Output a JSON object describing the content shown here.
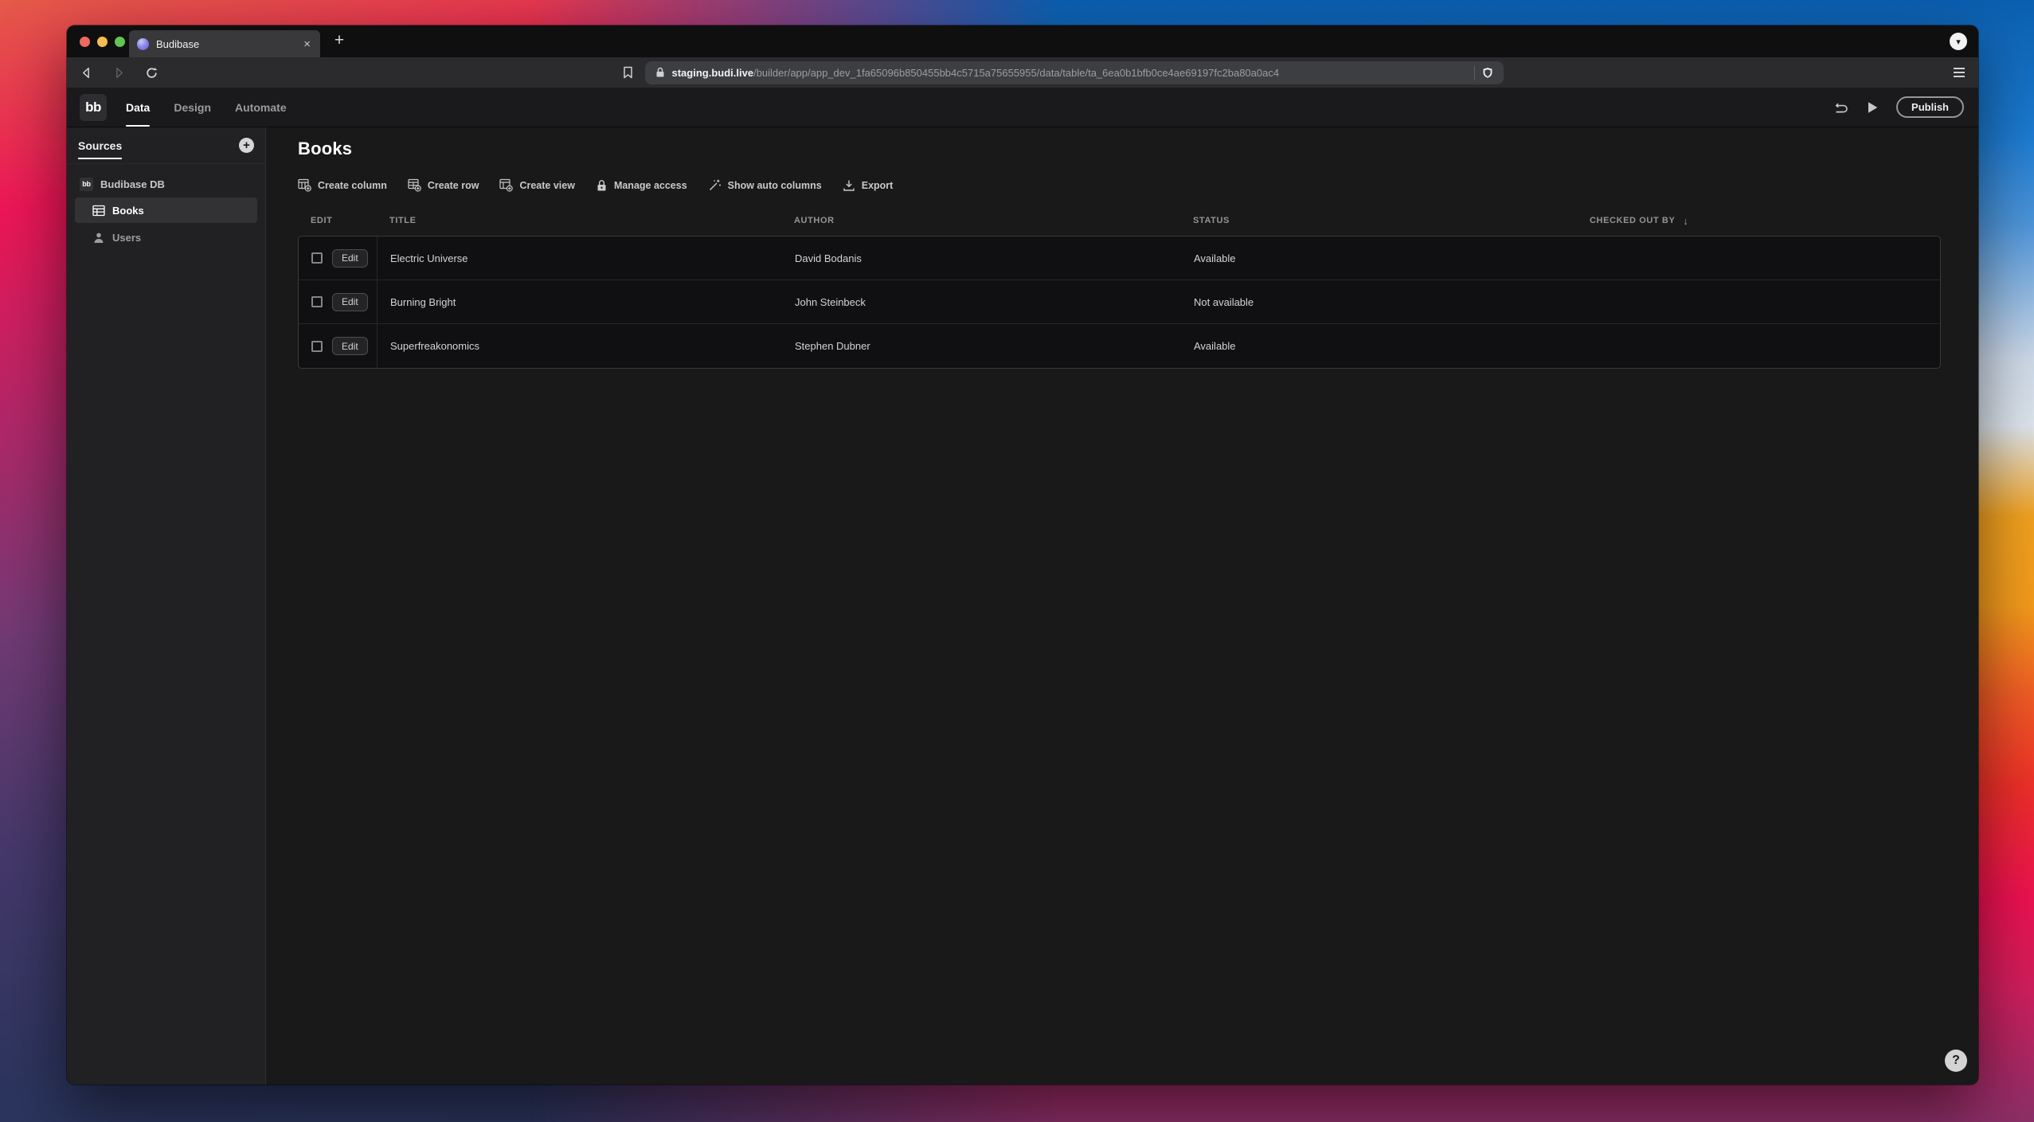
{
  "browser": {
    "tab": {
      "title": "Budibase"
    },
    "url": {
      "domain": "staging.budi.live",
      "path": "/builder/app/app_dev_1fa65096b850455bb4c5715a75655955/data/table/ta_6ea0b1bfb0ce4ae69197fc2ba80a0ac4"
    }
  },
  "icons": {
    "close": "×",
    "plus": "+",
    "chevron_down": "▾",
    "sort_desc": "↓",
    "help": "?"
  },
  "app": {
    "logo": "bb",
    "logo_mini": "bb",
    "nav_tabs": [
      {
        "label": "Data"
      },
      {
        "label": "Design"
      },
      {
        "label": "Automate"
      }
    ],
    "publish_label": "Publish"
  },
  "sidebar": {
    "title": "Sources",
    "datasource": "Budibase DB",
    "items": [
      {
        "label": "Books"
      },
      {
        "label": "Users"
      }
    ]
  },
  "main": {
    "title": "Books",
    "actions": [
      {
        "label": "Create column",
        "icon": "table-add-icon"
      },
      {
        "label": "Create row",
        "icon": "table-add-icon"
      },
      {
        "label": "Create view",
        "icon": "table-add-icon"
      },
      {
        "label": "Manage access",
        "icon": "lock-icon"
      },
      {
        "label": "Show auto columns",
        "icon": "magic-wand-icon"
      },
      {
        "label": "Export",
        "icon": "download-icon"
      }
    ],
    "table": {
      "columns": [
        "Edit",
        "Title",
        "Author",
        "Status",
        "Checked out by"
      ],
      "edit_label": "Edit",
      "rows": [
        {
          "title": "Electric Universe",
          "author": "David Bodanis",
          "status": "Available",
          "checked_out_by": ""
        },
        {
          "title": "Burning Bright",
          "author": "John Steinbeck",
          "status": "Not available",
          "checked_out_by": ""
        },
        {
          "title": "Superfreakonomics",
          "author": "Stephen Dubner",
          "status": "Available",
          "checked_out_by": ""
        }
      ]
    }
  },
  "colors": {
    "traffic_close": "#ee6a5e",
    "traffic_min": "#f5bd4f",
    "traffic_max": "#61c554",
    "favicon_purple": "#7d7ae8",
    "selection_bg": "#323234",
    "app_bg": "#191919",
    "sidebar_bg": "#212123"
  }
}
